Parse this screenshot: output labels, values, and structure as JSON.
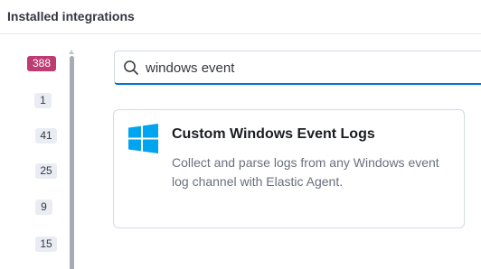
{
  "header": {
    "title": "Installed integrations"
  },
  "sidebar": {
    "counts": [
      "388",
      "1",
      "41",
      "25",
      "9",
      "15"
    ]
  },
  "search": {
    "value": "windows event",
    "icon": "search-icon"
  },
  "results": [
    {
      "title": "Custom Windows Event Logs",
      "description": "Collect and parse logs from any Windows event log channel with Elastic Agent.",
      "icon": "windows-logo-icon"
    }
  ],
  "colors": {
    "accent_badge": "#bd3c73",
    "windows_logo": "#00a4ef",
    "focus_border": "#0077cc"
  }
}
